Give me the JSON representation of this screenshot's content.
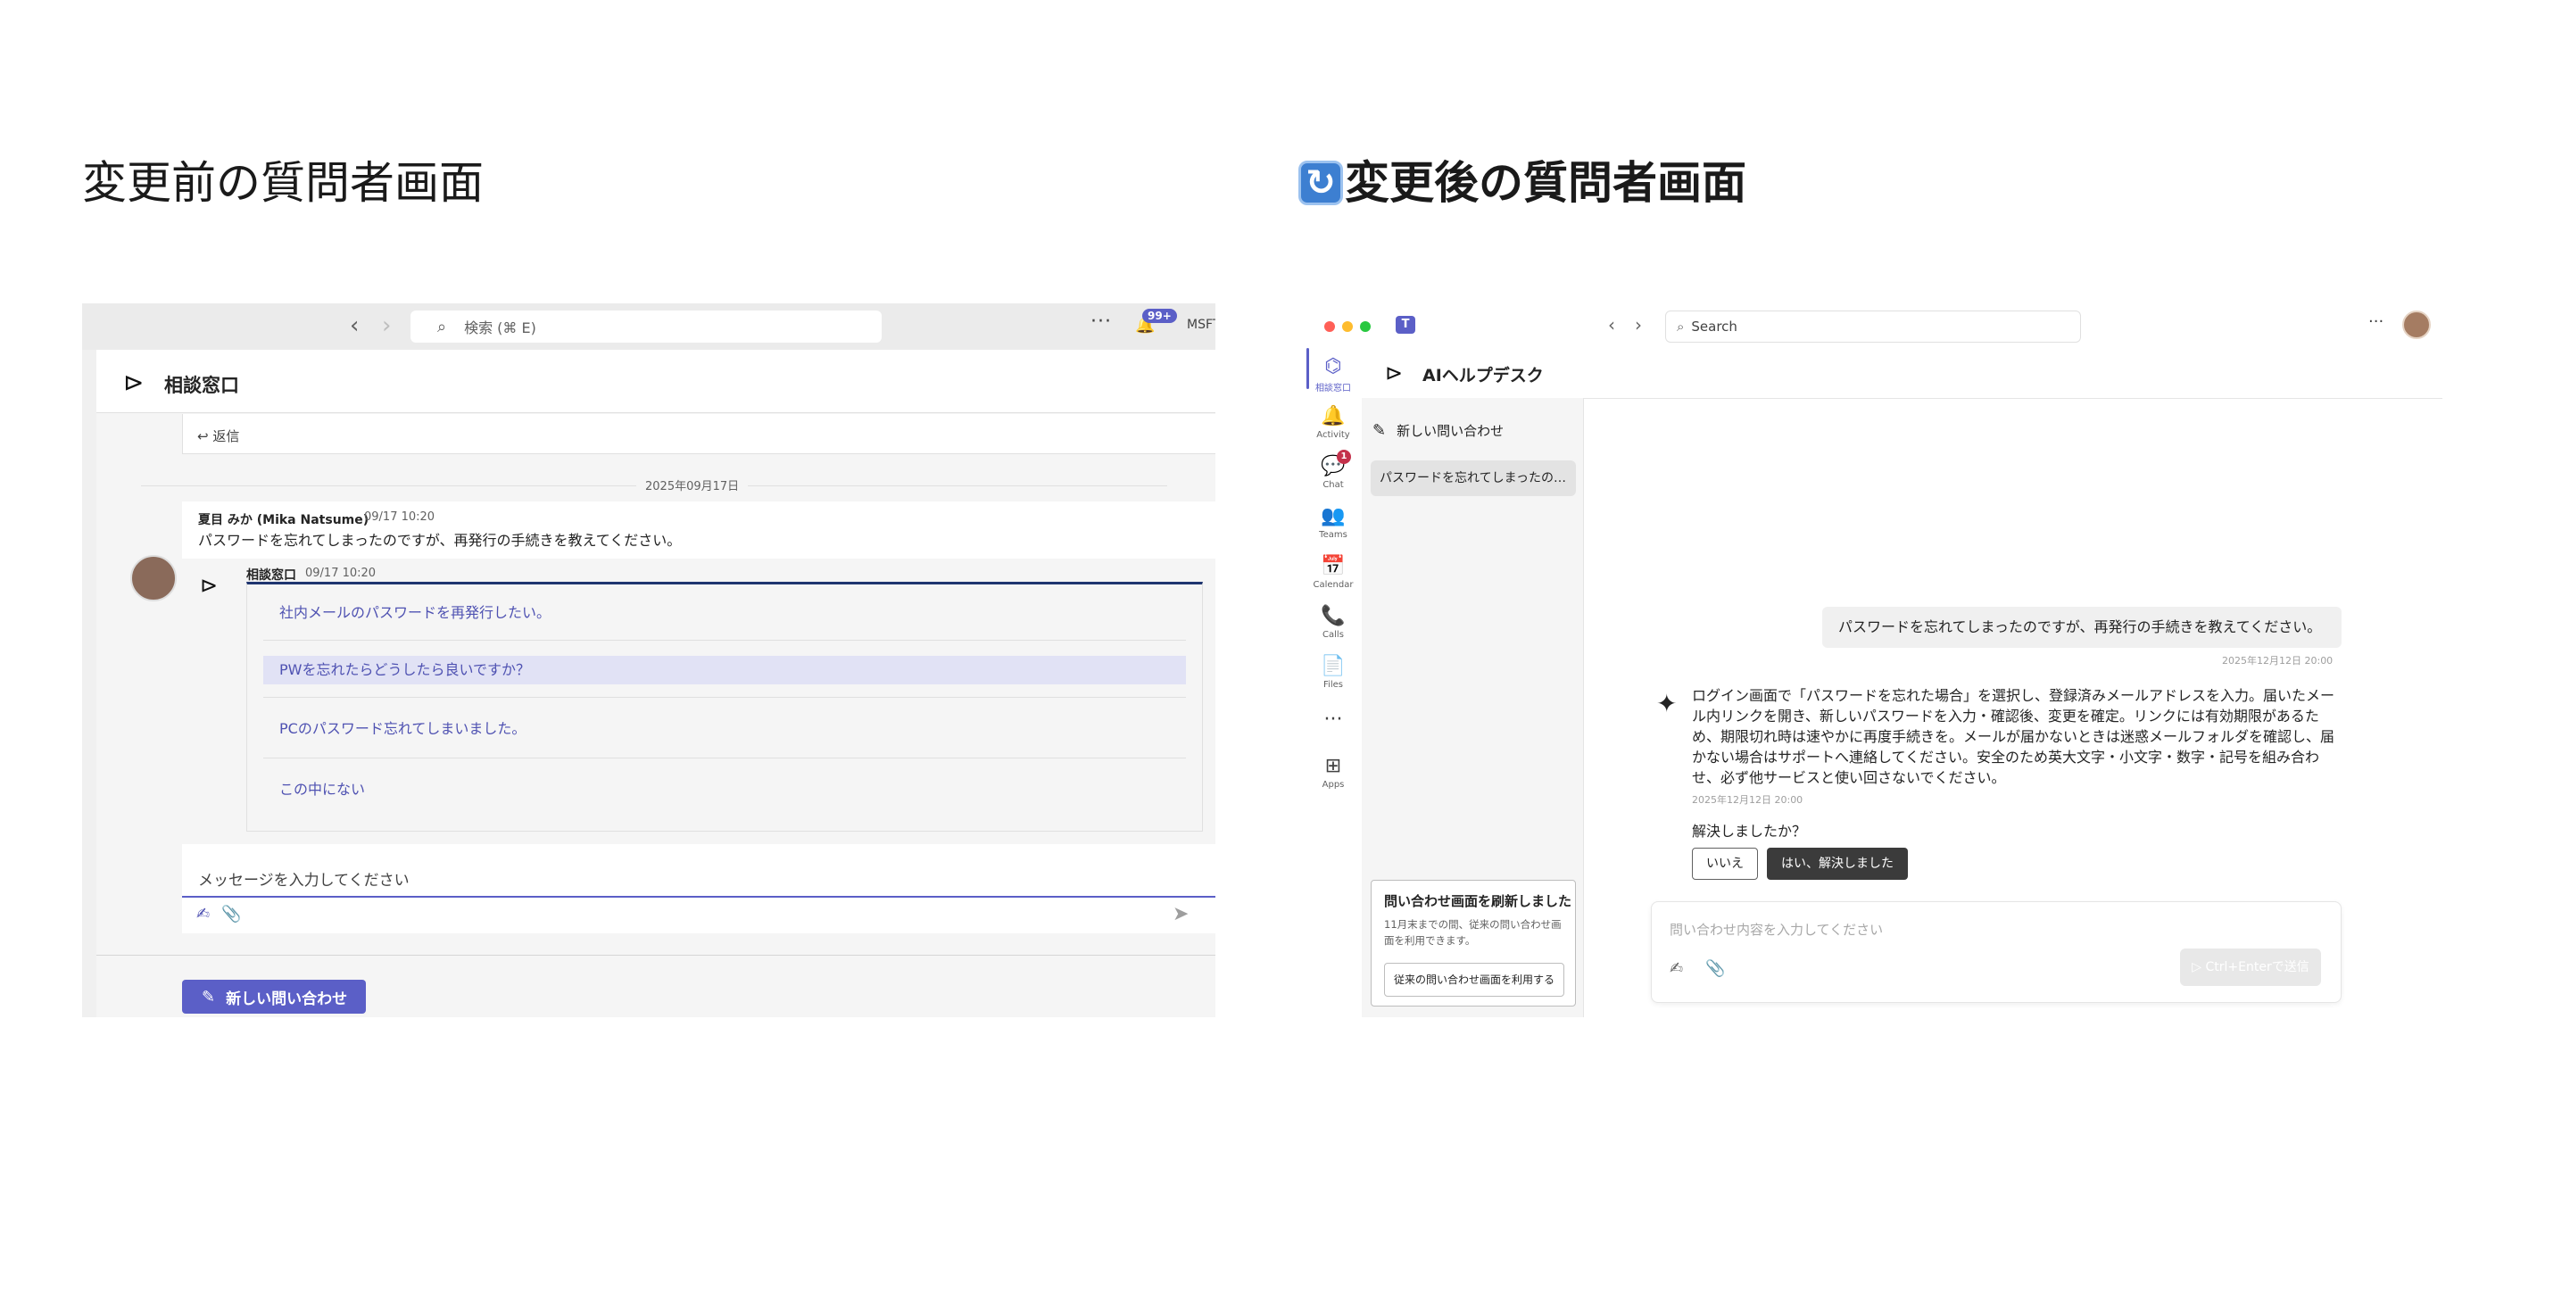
{
  "headings": {
    "before": "変更前の質問者画面",
    "after_icon": "refresh-emoji",
    "after": "変更後の質問者画面"
  },
  "before": {
    "topbar": {
      "back_icon": "‹",
      "forward_icon": "›",
      "search_placeholder": "検索 (⌘ E)",
      "more": "···",
      "badge": "99+",
      "org": "MSFT"
    },
    "header": {
      "title": "相談窓口"
    },
    "prev_reply": "↩ 返信",
    "date_separator": "2025年09月17日",
    "message": {
      "author": "夏目 みか (Mika Natsume)",
      "time": "09/17 10:20",
      "body": "パスワードを忘れてしまったのですが、再発行の手続きを教えてください。"
    },
    "bot": {
      "name": "相談窓口",
      "time": "09/17 10:20",
      "options": [
        "社内メールのパスワードを再発行したい。",
        "PWを忘れたらどうしたら良いですか？",
        "PCのパスワード忘れてしまいました。",
        "この中にない"
      ],
      "selected_index": 1
    },
    "input_placeholder": "メッセージを入力してください",
    "new_button": "新しい問い合わせ"
  },
  "after": {
    "window_controls": [
      "#ff5f57",
      "#febc2e",
      "#28c840"
    ],
    "search_placeholder": "Search",
    "more": "···",
    "rail": [
      {
        "label": "相談窓口",
        "icon": "⌬",
        "active": true
      },
      {
        "label": "Activity",
        "icon": "🔔"
      },
      {
        "label": "Chat",
        "icon": "💬"
      },
      {
        "label": "Teams",
        "icon": "👥"
      },
      {
        "label": "Calendar",
        "icon": "📅"
      },
      {
        "label": "Calls",
        "icon": "📞"
      },
      {
        "label": "Files",
        "icon": "📄"
      },
      {
        "label": "",
        "icon": "···"
      },
      {
        "label": "Apps",
        "icon": "⊞"
      }
    ],
    "chat_badge": "1",
    "app_title": "AIヘルプデスク",
    "new_inquiry": "新しい問い合わせ",
    "history_item": "パスワードを忘れてしまったの…",
    "notice": {
      "title": "問い合わせ画面を刷新しました",
      "body": "11月末までの間、従来の問い合わせ画面を利用できます。",
      "button": "従来の問い合わせ画面を利用する"
    },
    "user_message": "パスワードを忘れてしまったのですが、再発行の手続きを教えてください。",
    "user_time": "2025年12月12日 20:00",
    "answer": "ログイン画面で「パスワードを忘れた場合」を選択し、登録済みメールアドレスを入力。届いたメール内リンクを開き、新しいパスワードを入力・確認後、変更を確定。リンクには有効期限があるため、期限切れ時は速やかに再度手続きを。メールが届かないときは迷惑メールフォルダを確認し、届かない場合はサポートへ連絡してください。安全のため英大文字・小文字・数字・記号を組み合わせ、必ず他サービスと使い回さないでください。",
    "answer_time": "2025年12月12日 20:00",
    "resolved_question": "解決しましたか？",
    "btn_no": "いいえ",
    "btn_yes": "はい、解決しました",
    "composer_placeholder": "問い合わせ内容を入力してください",
    "send_label": "▷ Ctrl+Enterで送信"
  }
}
